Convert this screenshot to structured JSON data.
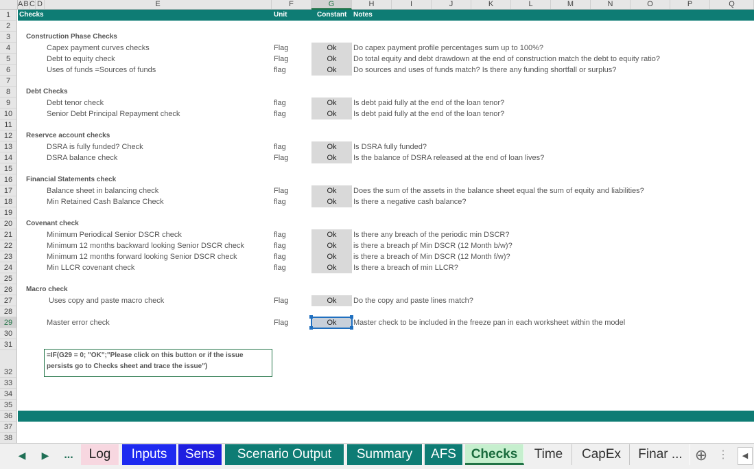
{
  "columns": {
    "a": "A",
    "b": "B",
    "c": "C",
    "d": "D",
    "e": "E",
    "f": "F",
    "g": "G",
    "h": "H",
    "i": "I",
    "j": "J",
    "k": "K",
    "l": "L",
    "m": "M",
    "n": "N",
    "o": "O",
    "p": "P",
    "q": "Q"
  },
  "rows": [
    "1",
    "2",
    "3",
    "4",
    "5",
    "6",
    "7",
    "8",
    "9",
    "10",
    "11",
    "12",
    "13",
    "14",
    "15",
    "16",
    "17",
    "18",
    "19",
    "20",
    "21",
    "22",
    "23",
    "24",
    "25",
    "26",
    "27",
    "28",
    "29",
    "30",
    "31",
    "32",
    "33",
    "34",
    "35",
    "36",
    "37",
    "38"
  ],
  "header": {
    "checks": "Checks",
    "unit": "Unit",
    "constant": "Constant",
    "notes": "Notes"
  },
  "sections": {
    "construction": "Construction Phase Checks",
    "debt": "Debt Checks",
    "reserve": "Reservce account checks",
    "financial": "Financial Statements check",
    "covenant": "Covenant check",
    "macro": "Macro check"
  },
  "checks": [
    {
      "label": "Capex payment curves checks",
      "unit": "Flag",
      "value": "Ok",
      "note": "Do capex payment profile percentages sum up to 100%?"
    },
    {
      "label": "Debt to equity check",
      "unit": "Flag",
      "value": "Ok",
      "note": "Do total equity and debt drawdown at the end of construction match the debt to equity ratio?"
    },
    {
      "label": "Uses of funds =Sources of funds",
      "unit": "flag",
      "value": "Ok",
      "note": "Do sources and uses of funds match? Is there any funding shortfall or surplus?"
    },
    {
      "label": "Debt tenor check",
      "unit": "flag",
      "value": "Ok",
      "note": "Is debt paid fully at the end of the loan tenor?"
    },
    {
      "label": "Senior Debt  Principal Repayment  check",
      "unit": "flag",
      "value": "Ok",
      "note": "Is debt paid fully at the end of the loan tenor?"
    },
    {
      "label": "DSRA is fully funded? Check",
      "unit": "flag",
      "value": "Ok",
      "note": "Is DSRA fully funded?"
    },
    {
      "label": "DSRA balance check",
      "unit": "Flag",
      "value": "Ok",
      "note": "Is the balance of DSRA released at the end of loan lives?"
    },
    {
      "label": "Balance sheet in balancing check",
      "unit": "Flag",
      "value": "Ok",
      "note": "Does the sum of the assets in the balance sheet equal the sum of equity and liabilities?"
    },
    {
      "label": "Min Retained Cash Balance Check",
      "unit": "flag",
      "value": "Ok",
      "note": "Is there a negative cash balance?"
    },
    {
      "label": "Minimum  Periodical Senior DSCR check",
      "unit": "flag",
      "value": "Ok",
      "note": "Is there any breach of the periodic min DSCR?"
    },
    {
      "label": "Minimum  12 months backward looking Senior DSCR check",
      "unit": "flag",
      "value": "Ok",
      "note": "is there a breach pf Min DSCR (12 Month b/w)?"
    },
    {
      "label": "Minimum  12 months forward looking Senior DSCR check",
      "unit": "flag",
      "value": "Ok",
      "note": "is there a breach of Min DSCR (12 Month f/w)?"
    },
    {
      "label": "Min LLCR covenant check",
      "unit": "flag",
      "value": "Ok",
      "note": "Is there a breach of min LLCR?"
    },
    {
      "label": " Uses copy and paste macro check",
      "unit": "Flag",
      "value": "Ok",
      "note": "Do the copy and paste lines match?"
    },
    {
      "label": "Master error check",
      "unit": "Flag",
      "value": "Ok",
      "note": "Master check to be included in the freeze pan in each worksheet within the model"
    }
  ],
  "macro_formula": "=IF(G29 = 0; \"OK\";\"Please click on this button or if the issue persists go to Checks sheet and trace the issue\")",
  "tabs": {
    "prev": "◀",
    "next": "▶",
    "more": "...",
    "log": "Log",
    "inputs": "Inputs",
    "sens": "Sens",
    "scenario": "Scenario Output",
    "summary": "Summary",
    "afs": "AFS",
    "checks": "Checks",
    "time": "Time",
    "capex": "CapEx",
    "finan": "Finar ...",
    "add": "⊕",
    "menu": "⋮",
    "scroll": "◀"
  },
  "colors": {
    "teal": "#0e7c74",
    "selection": "#1f6fbf",
    "excel_green": "#217346"
  }
}
